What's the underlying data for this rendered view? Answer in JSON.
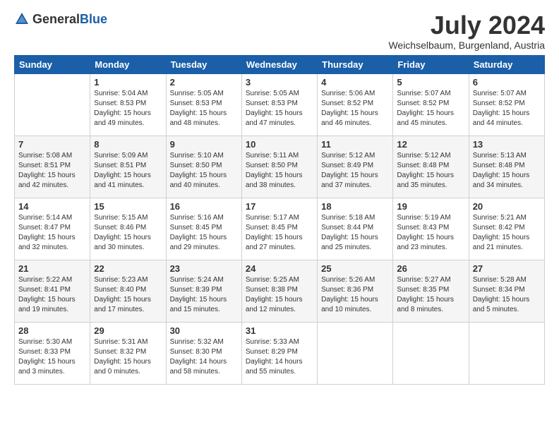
{
  "logo": {
    "general": "General",
    "blue": "Blue"
  },
  "header": {
    "month": "July 2024",
    "location": "Weichselbaum, Burgenland, Austria"
  },
  "days_of_week": [
    "Sunday",
    "Monday",
    "Tuesday",
    "Wednesday",
    "Thursday",
    "Friday",
    "Saturday"
  ],
  "weeks": [
    [
      {
        "day": "",
        "info": ""
      },
      {
        "day": "1",
        "info": "Sunrise: 5:04 AM\nSunset: 8:53 PM\nDaylight: 15 hours\nand 49 minutes."
      },
      {
        "day": "2",
        "info": "Sunrise: 5:05 AM\nSunset: 8:53 PM\nDaylight: 15 hours\nand 48 minutes."
      },
      {
        "day": "3",
        "info": "Sunrise: 5:05 AM\nSunset: 8:53 PM\nDaylight: 15 hours\nand 47 minutes."
      },
      {
        "day": "4",
        "info": "Sunrise: 5:06 AM\nSunset: 8:52 PM\nDaylight: 15 hours\nand 46 minutes."
      },
      {
        "day": "5",
        "info": "Sunrise: 5:07 AM\nSunset: 8:52 PM\nDaylight: 15 hours\nand 45 minutes."
      },
      {
        "day": "6",
        "info": "Sunrise: 5:07 AM\nSunset: 8:52 PM\nDaylight: 15 hours\nand 44 minutes."
      }
    ],
    [
      {
        "day": "7",
        "info": "Sunrise: 5:08 AM\nSunset: 8:51 PM\nDaylight: 15 hours\nand 42 minutes."
      },
      {
        "day": "8",
        "info": "Sunrise: 5:09 AM\nSunset: 8:51 PM\nDaylight: 15 hours\nand 41 minutes."
      },
      {
        "day": "9",
        "info": "Sunrise: 5:10 AM\nSunset: 8:50 PM\nDaylight: 15 hours\nand 40 minutes."
      },
      {
        "day": "10",
        "info": "Sunrise: 5:11 AM\nSunset: 8:50 PM\nDaylight: 15 hours\nand 38 minutes."
      },
      {
        "day": "11",
        "info": "Sunrise: 5:12 AM\nSunset: 8:49 PM\nDaylight: 15 hours\nand 37 minutes."
      },
      {
        "day": "12",
        "info": "Sunrise: 5:12 AM\nSunset: 8:48 PM\nDaylight: 15 hours\nand 35 minutes."
      },
      {
        "day": "13",
        "info": "Sunrise: 5:13 AM\nSunset: 8:48 PM\nDaylight: 15 hours\nand 34 minutes."
      }
    ],
    [
      {
        "day": "14",
        "info": "Sunrise: 5:14 AM\nSunset: 8:47 PM\nDaylight: 15 hours\nand 32 minutes."
      },
      {
        "day": "15",
        "info": "Sunrise: 5:15 AM\nSunset: 8:46 PM\nDaylight: 15 hours\nand 30 minutes."
      },
      {
        "day": "16",
        "info": "Sunrise: 5:16 AM\nSunset: 8:45 PM\nDaylight: 15 hours\nand 29 minutes."
      },
      {
        "day": "17",
        "info": "Sunrise: 5:17 AM\nSunset: 8:45 PM\nDaylight: 15 hours\nand 27 minutes."
      },
      {
        "day": "18",
        "info": "Sunrise: 5:18 AM\nSunset: 8:44 PM\nDaylight: 15 hours\nand 25 minutes."
      },
      {
        "day": "19",
        "info": "Sunrise: 5:19 AM\nSunset: 8:43 PM\nDaylight: 15 hours\nand 23 minutes."
      },
      {
        "day": "20",
        "info": "Sunrise: 5:21 AM\nSunset: 8:42 PM\nDaylight: 15 hours\nand 21 minutes."
      }
    ],
    [
      {
        "day": "21",
        "info": "Sunrise: 5:22 AM\nSunset: 8:41 PM\nDaylight: 15 hours\nand 19 minutes."
      },
      {
        "day": "22",
        "info": "Sunrise: 5:23 AM\nSunset: 8:40 PM\nDaylight: 15 hours\nand 17 minutes."
      },
      {
        "day": "23",
        "info": "Sunrise: 5:24 AM\nSunset: 8:39 PM\nDaylight: 15 hours\nand 15 minutes."
      },
      {
        "day": "24",
        "info": "Sunrise: 5:25 AM\nSunset: 8:38 PM\nDaylight: 15 hours\nand 12 minutes."
      },
      {
        "day": "25",
        "info": "Sunrise: 5:26 AM\nSunset: 8:36 PM\nDaylight: 15 hours\nand 10 minutes."
      },
      {
        "day": "26",
        "info": "Sunrise: 5:27 AM\nSunset: 8:35 PM\nDaylight: 15 hours\nand 8 minutes."
      },
      {
        "day": "27",
        "info": "Sunrise: 5:28 AM\nSunset: 8:34 PM\nDaylight: 15 hours\nand 5 minutes."
      }
    ],
    [
      {
        "day": "28",
        "info": "Sunrise: 5:30 AM\nSunset: 8:33 PM\nDaylight: 15 hours\nand 3 minutes."
      },
      {
        "day": "29",
        "info": "Sunrise: 5:31 AM\nSunset: 8:32 PM\nDaylight: 15 hours\nand 0 minutes."
      },
      {
        "day": "30",
        "info": "Sunrise: 5:32 AM\nSunset: 8:30 PM\nDaylight: 14 hours\nand 58 minutes."
      },
      {
        "day": "31",
        "info": "Sunrise: 5:33 AM\nSunset: 8:29 PM\nDaylight: 14 hours\nand 55 minutes."
      },
      {
        "day": "",
        "info": ""
      },
      {
        "day": "",
        "info": ""
      },
      {
        "day": "",
        "info": ""
      }
    ]
  ]
}
